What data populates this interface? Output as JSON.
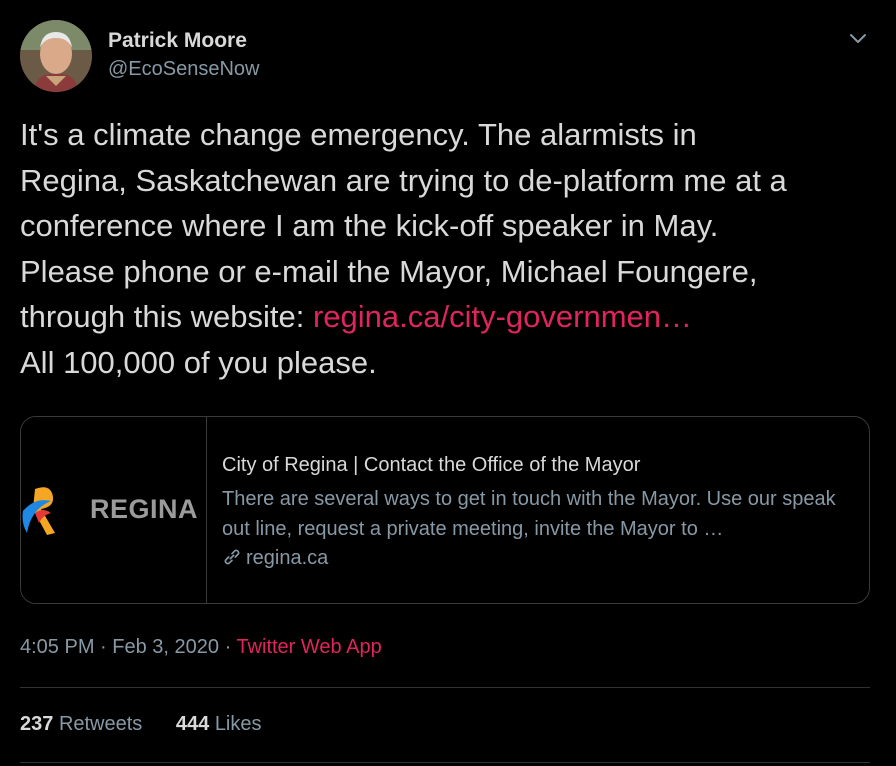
{
  "author": {
    "name": "Patrick Moore",
    "handle": "@EcoSenseNow"
  },
  "tweet": {
    "lines": [
      "It's a climate change emergency. The alarmists in",
      "Regina, Saskatchewan are trying to de-platform me at a",
      "conference where I am the kick-off speaker in May.",
      "Please phone or e-mail the Mayor, Michael Foungere,",
      "through this website: "
    ],
    "link_text": "regina.ca/city-governmen…",
    "last_line": "All 100,000 of you please."
  },
  "card": {
    "logo_text": "REGINA",
    "title": "City of Regina | Contact the Office of the Mayor",
    "description": "There are several ways to get in touch with the Mayor. Use our speak out line, request a private meeting, invite the Mayor to …",
    "domain": "regina.ca"
  },
  "meta": {
    "time": "4:05 PM",
    "sep1": " · ",
    "date": "Feb 3, 2020",
    "sep2": " · ",
    "source": "Twitter Web App"
  },
  "stats": {
    "retweets_count": "237",
    "retweets_label": "Retweets",
    "likes_count": "444",
    "likes_label": "Likes"
  },
  "colors": {
    "background": "#000000",
    "link": "#e0245e",
    "secondary_text": "#8899a6",
    "primary_text": "#d9d9d9"
  },
  "icons": {
    "caret": "chevron-down-icon",
    "link": "link-icon"
  }
}
